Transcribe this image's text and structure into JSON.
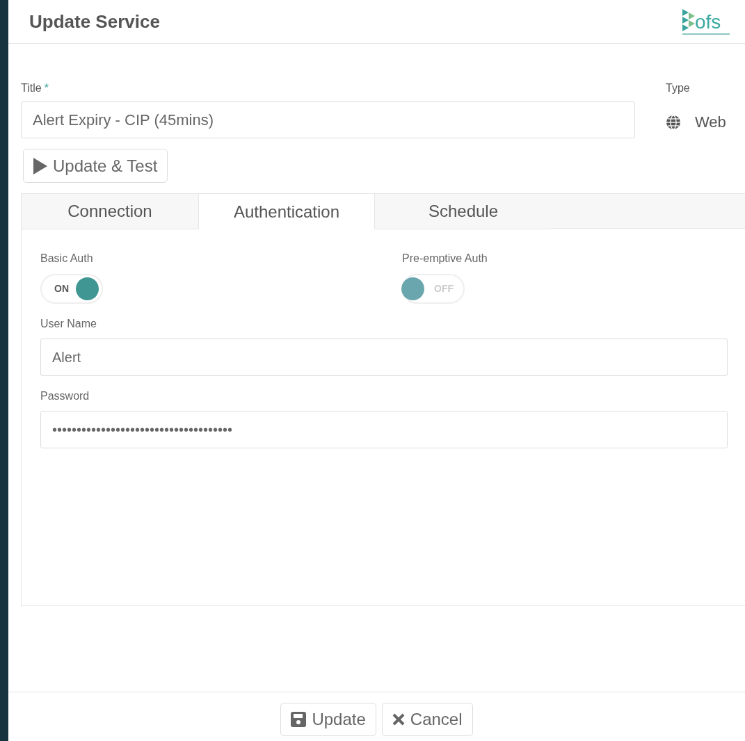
{
  "dialog": {
    "title": "Update Service",
    "logo_text": "ofs"
  },
  "title_field": {
    "label": "Title",
    "required_mark": "*",
    "value": "Alert Expiry - CIP (45mins)"
  },
  "type_field": {
    "label": "Type",
    "value": "Web"
  },
  "test_button": {
    "label": "Update & Test"
  },
  "tabs": [
    {
      "label": "Connection",
      "selected": false
    },
    {
      "label": "Authentication",
      "selected": true
    },
    {
      "label": "Schedule",
      "selected": false
    }
  ],
  "toggles": [
    {
      "label": "Basic Auth",
      "on": true,
      "state_text": "ON"
    },
    {
      "label": "Pre-emptive Auth",
      "on": false,
      "state_text": "OFF"
    }
  ],
  "fields": [
    {
      "label": "User Name",
      "value": "Alert"
    },
    {
      "label": "Password",
      "value": "•••••••••••••••••••••••••••••••••••••"
    }
  ],
  "footer_buttons": [
    {
      "kind": "save",
      "label": "Update"
    },
    {
      "kind": "cancel",
      "label": "Cancel"
    }
  ]
}
